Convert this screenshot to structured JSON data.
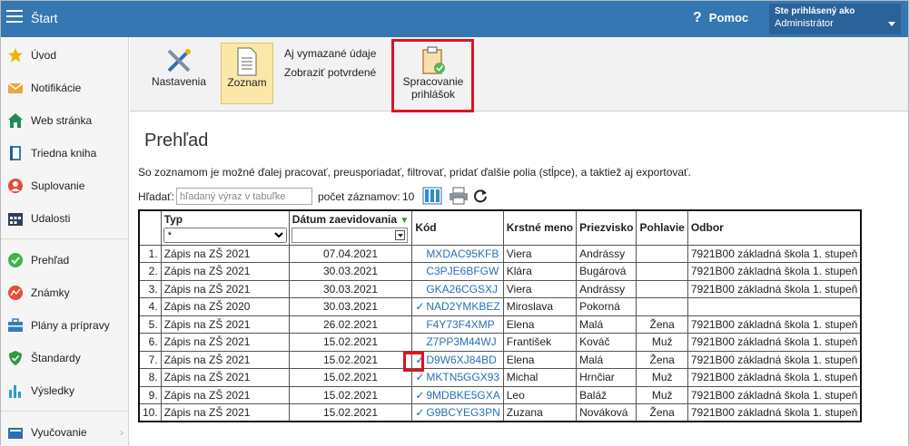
{
  "topbar": {
    "title": "Štart",
    "help_label": "Pomoc",
    "user_line1": "Ste prihlásený ako",
    "user_line2": "Administrátor"
  },
  "sidebar": {
    "items": [
      {
        "label": "Úvod",
        "icon": "star-icon"
      },
      {
        "label": "Notifikácie",
        "icon": "envelope-icon"
      },
      {
        "label": "Web stránka",
        "icon": "house-icon"
      },
      {
        "label": "Triedna kniha",
        "icon": "book-icon"
      },
      {
        "label": "Suplovanie",
        "icon": "person-icon"
      },
      {
        "label": "Udalosti",
        "icon": "calendar-icon"
      },
      {
        "label": "Prehľad",
        "icon": "check-circle-icon"
      },
      {
        "label": "Známky",
        "icon": "chart-circle-icon"
      },
      {
        "label": "Plány a prípravy",
        "icon": "briefcase-icon"
      },
      {
        "label": "Štandardy",
        "icon": "shield-icon"
      },
      {
        "label": "Výsledky",
        "icon": "bar-chart-icon"
      },
      {
        "label": "Vyučovanie",
        "icon": "book-stack-icon"
      }
    ]
  },
  "toolbar": {
    "settings_label": "Nastavenia",
    "list_label": "Zoznam",
    "link_deleted": "Aj vymazané údaje",
    "link_confirmed": "Zobraziť potvrdené",
    "process_label_1": "Spracovanie",
    "process_label_2": "prihlášok"
  },
  "main": {
    "title": "Prehľad",
    "description": "So zoznamom je možné ďalej pracovať, preusporiadať, filtrovať, pridať ďalšie polia (stĺpce), a taktiež aj exportovať.",
    "search_label": "Hľadať:",
    "search_placeholder": "hľadaný výraz v tabuľke",
    "count_label": "počet záznamov:",
    "count_value": "10"
  },
  "table": {
    "headers": {
      "typ": "Typ",
      "datum": "Dátum zaevidovania",
      "kod": "Kód",
      "meno": "Krstné meno",
      "priezvisko": "Priezvisko",
      "pohlavie": "Pohlavie",
      "odbor": "Odbor"
    },
    "typ_filter": "*",
    "rows": [
      {
        "n": "1.",
        "typ": "Zápis na ZŠ 2021",
        "datum": "07.04.2021",
        "check": "",
        "kod": "MXDAC95KFB",
        "meno": "Viera",
        "priezvisko": "Andrássy",
        "pohlavie": "",
        "odbor": "7921B00 základná škola 1. stupeň"
      },
      {
        "n": "2.",
        "typ": "Zápis na ZŠ 2021",
        "datum": "30.03.2021",
        "check": "",
        "kod": "C3PJE6BFGW",
        "meno": "Klára",
        "priezvisko": "Bugárová",
        "pohlavie": "",
        "odbor": "7921B00 základná škola 1. stupeň"
      },
      {
        "n": "3.",
        "typ": "Zápis na ZŠ 2021",
        "datum": "30.03.2021",
        "check": "",
        "kod": "GKA26CGSXJ",
        "meno": "Viera",
        "priezvisko": "Andrássy",
        "pohlavie": "",
        "odbor": "7921B00 základná škola 1. stupeň"
      },
      {
        "n": "4.",
        "typ": "Zápis na ZŠ 2020",
        "datum": "30.03.2021",
        "check": "✓",
        "kod": "NAD2YMKBEZ",
        "meno": "Miroslava",
        "priezvisko": "Pokorná",
        "pohlavie": "",
        "odbor": ""
      },
      {
        "n": "5.",
        "typ": "Zápis na ZŠ 2021",
        "datum": "26.02.2021",
        "check": "",
        "kod": "F4Y73F4XMP",
        "meno": "Elena",
        "priezvisko": "Malá",
        "pohlavie": "Žena",
        "odbor": "7921B00 základná škola 1. stupeň"
      },
      {
        "n": "6.",
        "typ": "Zápis na ZŠ 2021",
        "datum": "15.02.2021",
        "check": "",
        "kod": "Z7PP3M44WJ",
        "meno": "František",
        "priezvisko": "Kováč",
        "pohlavie": "Muž",
        "odbor": "7921B00 základná škola 1. stupeň"
      },
      {
        "n": "7.",
        "typ": "Zápis na ZŠ 2021",
        "datum": "15.02.2021",
        "check": "✓",
        "kod": "D9W6XJ84BD",
        "meno": "Elena",
        "priezvisko": "Malá",
        "pohlavie": "Žena",
        "odbor": "7921B00 základná škola 1. stupeň"
      },
      {
        "n": "8.",
        "typ": "Zápis na ZŠ 2021",
        "datum": "15.02.2021",
        "check": "✓",
        "kod": "MKTN5GGX93",
        "meno": "Michal",
        "priezvisko": "Hrnčiar",
        "pohlavie": "Muž",
        "odbor": "7921B00 základná škola 1. stupeň"
      },
      {
        "n": "9.",
        "typ": "Zápis na ZŠ 2021",
        "datum": "15.02.2021",
        "check": "✓",
        "kod": "9MDBKE5GXA",
        "meno": "Leo",
        "priezvisko": "Baláž",
        "pohlavie": "Muž",
        "odbor": "7921B00 základná škola 1. stupeň"
      },
      {
        "n": "10.",
        "typ": "Zápis na ZŠ 2021",
        "datum": "15.02.2021",
        "check": "✓",
        "kod": "G9BCYEG3PN",
        "meno": "Zuzana",
        "priezvisko": "Nováková",
        "pohlavie": "Žena",
        "odbor": "7921B00 základná škola 1. stupeň"
      }
    ]
  },
  "colors": {
    "topbar": "#3577b3",
    "highlight": "#e0121b",
    "link": "#2a6fb5"
  }
}
